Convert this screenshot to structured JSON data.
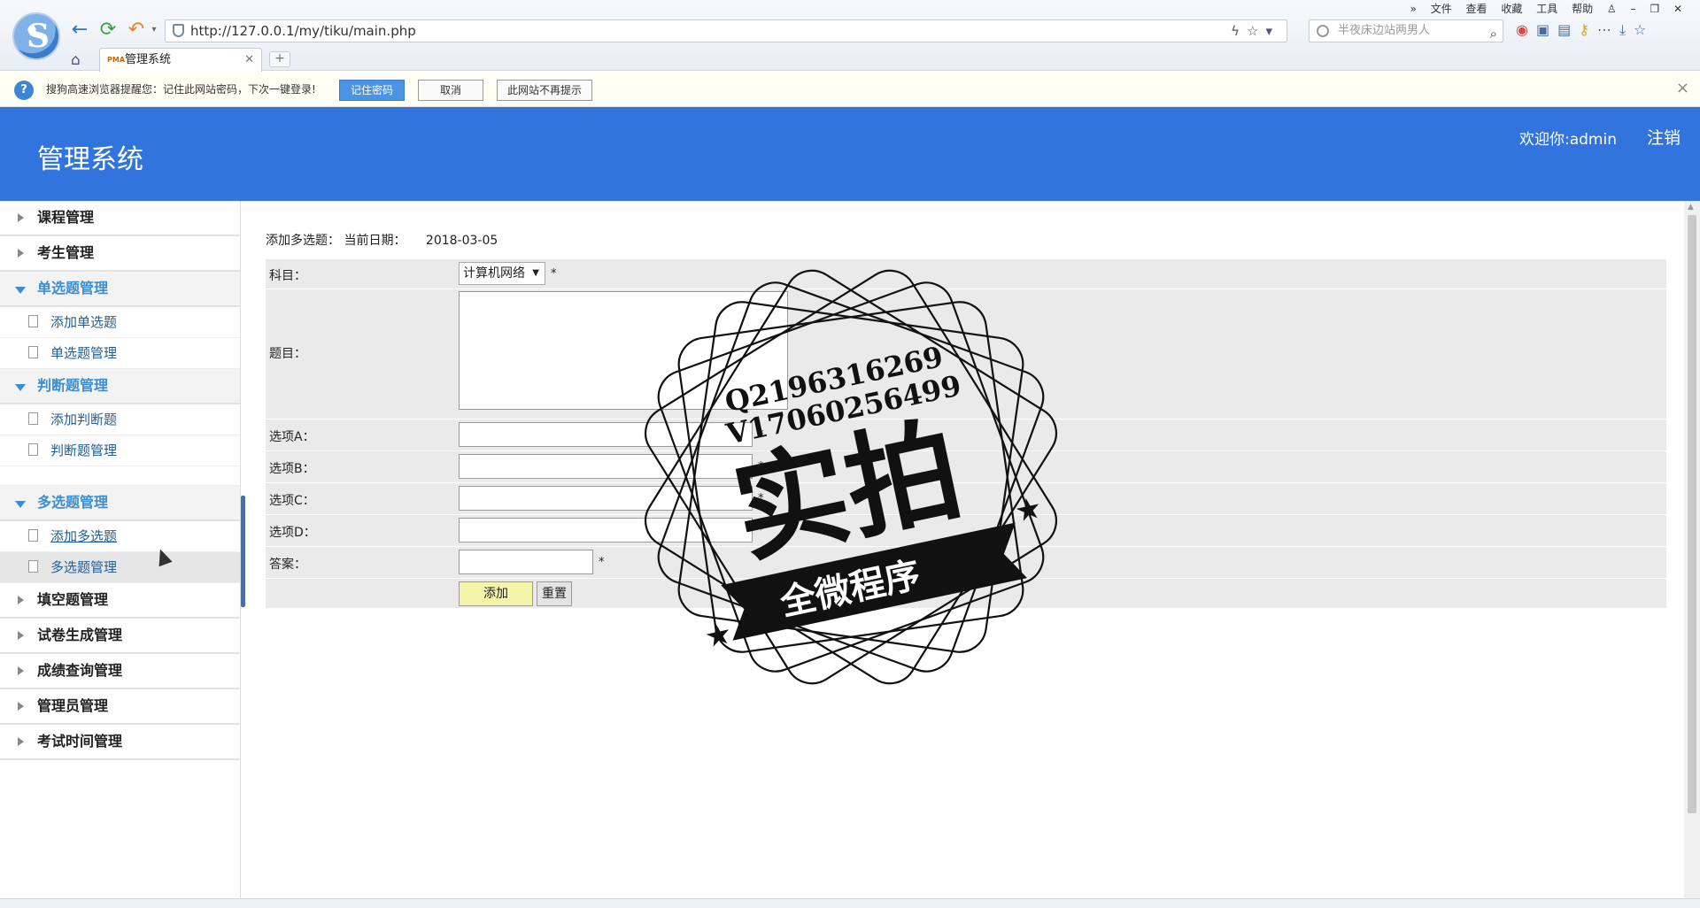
{
  "browser": {
    "url": "http://127.0.0.1/my/tiku/main.php",
    "search_placeholder": "半夜床边站两男人",
    "menu": [
      "文件",
      "查看",
      "收藏",
      "工具",
      "帮助"
    ],
    "tab_title": "管理系统",
    "tab_favicon": "PMA"
  },
  "password_bar": {
    "message": "搜狗高速浏览器提醒您：记住此网站密码，下次一键登录!",
    "remember": "记住密码",
    "cancel": "取消",
    "never": "此网站不再提示"
  },
  "header": {
    "title": "管理系统",
    "welcome": "欢迎你:admin",
    "logout": "注销"
  },
  "sidebar": {
    "course": "课程管理",
    "student": "考生管理",
    "single": {
      "title": "单选题管理",
      "add": "添加单选题",
      "manage": "单选题管理"
    },
    "judge": {
      "title": "判断题管理",
      "add": "添加判断题",
      "manage": "判断题管理"
    },
    "multi": {
      "title": "多选题管理",
      "add": "添加多选题",
      "manage": "多选题管理"
    },
    "fill": "填空题管理",
    "paper": "试卷生成管理",
    "score": "成绩查询管理",
    "admin": "管理员管理",
    "exam_time": "考试时间管理"
  },
  "content": {
    "heading": "添加多选题：",
    "date_label": "当前日期：",
    "date": "2018-03-05",
    "subject_label": "科目：",
    "subject_value": "计算机网络",
    "question_label": "题目：",
    "option_a": "选项A：",
    "option_b": "选项B：",
    "option_c": "选项C：",
    "option_d": "选项D：",
    "answer_label": "答案：",
    "required_mark": "*",
    "add_button": "添加",
    "reset_button": "重置"
  },
  "watermark": {
    "qq": "Q2196316269",
    "wechat": "V17060256499",
    "main": "实拍",
    "banner": "全微程序"
  }
}
